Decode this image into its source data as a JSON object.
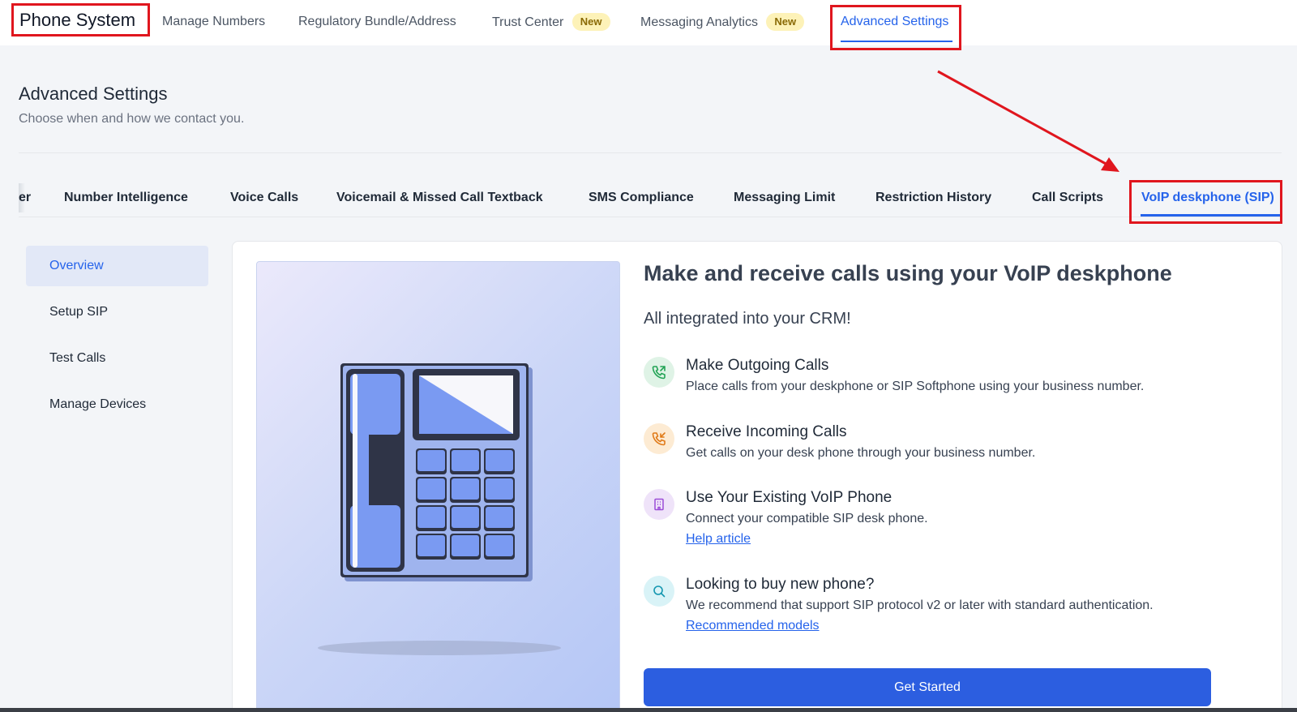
{
  "header": {
    "title": "Phone System",
    "nav": [
      {
        "label": "Manage Numbers",
        "badge": null
      },
      {
        "label": "Regulatory Bundle/Address",
        "badge": null
      },
      {
        "label": "Trust Center",
        "badge": "New"
      },
      {
        "label": "Messaging Analytics",
        "badge": "New"
      },
      {
        "label": "Advanced Settings",
        "badge": null,
        "active": true
      }
    ]
  },
  "page": {
    "title": "Advanced Settings",
    "subtitle": "Choose when and how we contact you."
  },
  "subtabs": [
    {
      "label": "er"
    },
    {
      "label": "Number Intelligence"
    },
    {
      "label": "Voice Calls"
    },
    {
      "label": "Voicemail & Missed Call Textback"
    },
    {
      "label": "SMS Compliance"
    },
    {
      "label": "Messaging Limit"
    },
    {
      "label": "Restriction History"
    },
    {
      "label": "Call Scripts"
    },
    {
      "label": "VoIP deskphone (SIP)",
      "active": true
    }
  ],
  "sidebar": {
    "items": [
      {
        "label": "Overview",
        "active": true
      },
      {
        "label": "Setup SIP"
      },
      {
        "label": "Test Calls"
      },
      {
        "label": "Manage Devices"
      }
    ]
  },
  "main": {
    "title": "Make and receive calls using your VoIP deskphone",
    "subtitle": "All integrated into your CRM!",
    "features": [
      {
        "icon": "outgoing-call-icon",
        "title": "Make Outgoing Calls",
        "description": "Place calls from your deskphone or SIP Softphone using your business number.",
        "link": null
      },
      {
        "icon": "incoming-call-icon",
        "title": "Receive Incoming Calls",
        "description": "Get calls on your desk phone through your business number.",
        "link": null
      },
      {
        "icon": "building-icon",
        "title": "Use Your Existing VoIP Phone",
        "description": "Connect your compatible SIP desk phone.",
        "link": "Help article"
      },
      {
        "icon": "search-icon",
        "title": "Looking to buy new phone?",
        "description": "We recommend that support SIP protocol v2 or later with standard authentication.",
        "link": "Recommended models"
      }
    ],
    "cta": "Get Started"
  },
  "colors": {
    "accent": "#2563eb",
    "cta": "#2c5ee0",
    "highlight_box": "#e0161e",
    "badge_bg": "#fdf2b8"
  }
}
